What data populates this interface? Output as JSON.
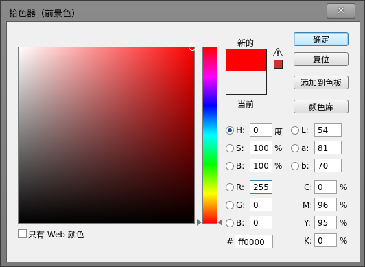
{
  "window": {
    "title": "拾色器（前景色）",
    "close_glyph": "✕"
  },
  "swatches": {
    "new_label": "新的",
    "current_label": "当前",
    "new_color": "#ff0000",
    "current_color": "#f0f0f0",
    "websafe_color": "#cc3333"
  },
  "buttons": {
    "ok": "确定",
    "reset": "复位",
    "add_swatch": "添加到色板",
    "library": "颜色库"
  },
  "hsb": {
    "h": {
      "label": "H:",
      "value": "0",
      "unit": "度",
      "selected": true
    },
    "s": {
      "label": "S:",
      "value": "100",
      "unit": "%"
    },
    "b": {
      "label": "B:",
      "value": "100",
      "unit": "%"
    }
  },
  "lab": {
    "l": {
      "label": "L:",
      "value": "54"
    },
    "a": {
      "label": "a:",
      "value": "81"
    },
    "b": {
      "label": "b:",
      "value": "70"
    }
  },
  "rgb": {
    "r": {
      "label": "R:",
      "value": "255"
    },
    "g": {
      "label": "G:",
      "value": "0"
    },
    "b": {
      "label": "B:",
      "value": "0"
    }
  },
  "cmyk": {
    "c": {
      "label": "C:",
      "value": "0",
      "unit": "%"
    },
    "m": {
      "label": "M:",
      "value": "96",
      "unit": "%"
    },
    "y": {
      "label": "Y:",
      "value": "95",
      "unit": "%"
    },
    "k": {
      "label": "K:",
      "value": "0",
      "unit": "%"
    }
  },
  "hex": {
    "label": "#",
    "value": "ff0000"
  },
  "web_only": {
    "label": "只有 Web 颜色",
    "checked": false
  }
}
